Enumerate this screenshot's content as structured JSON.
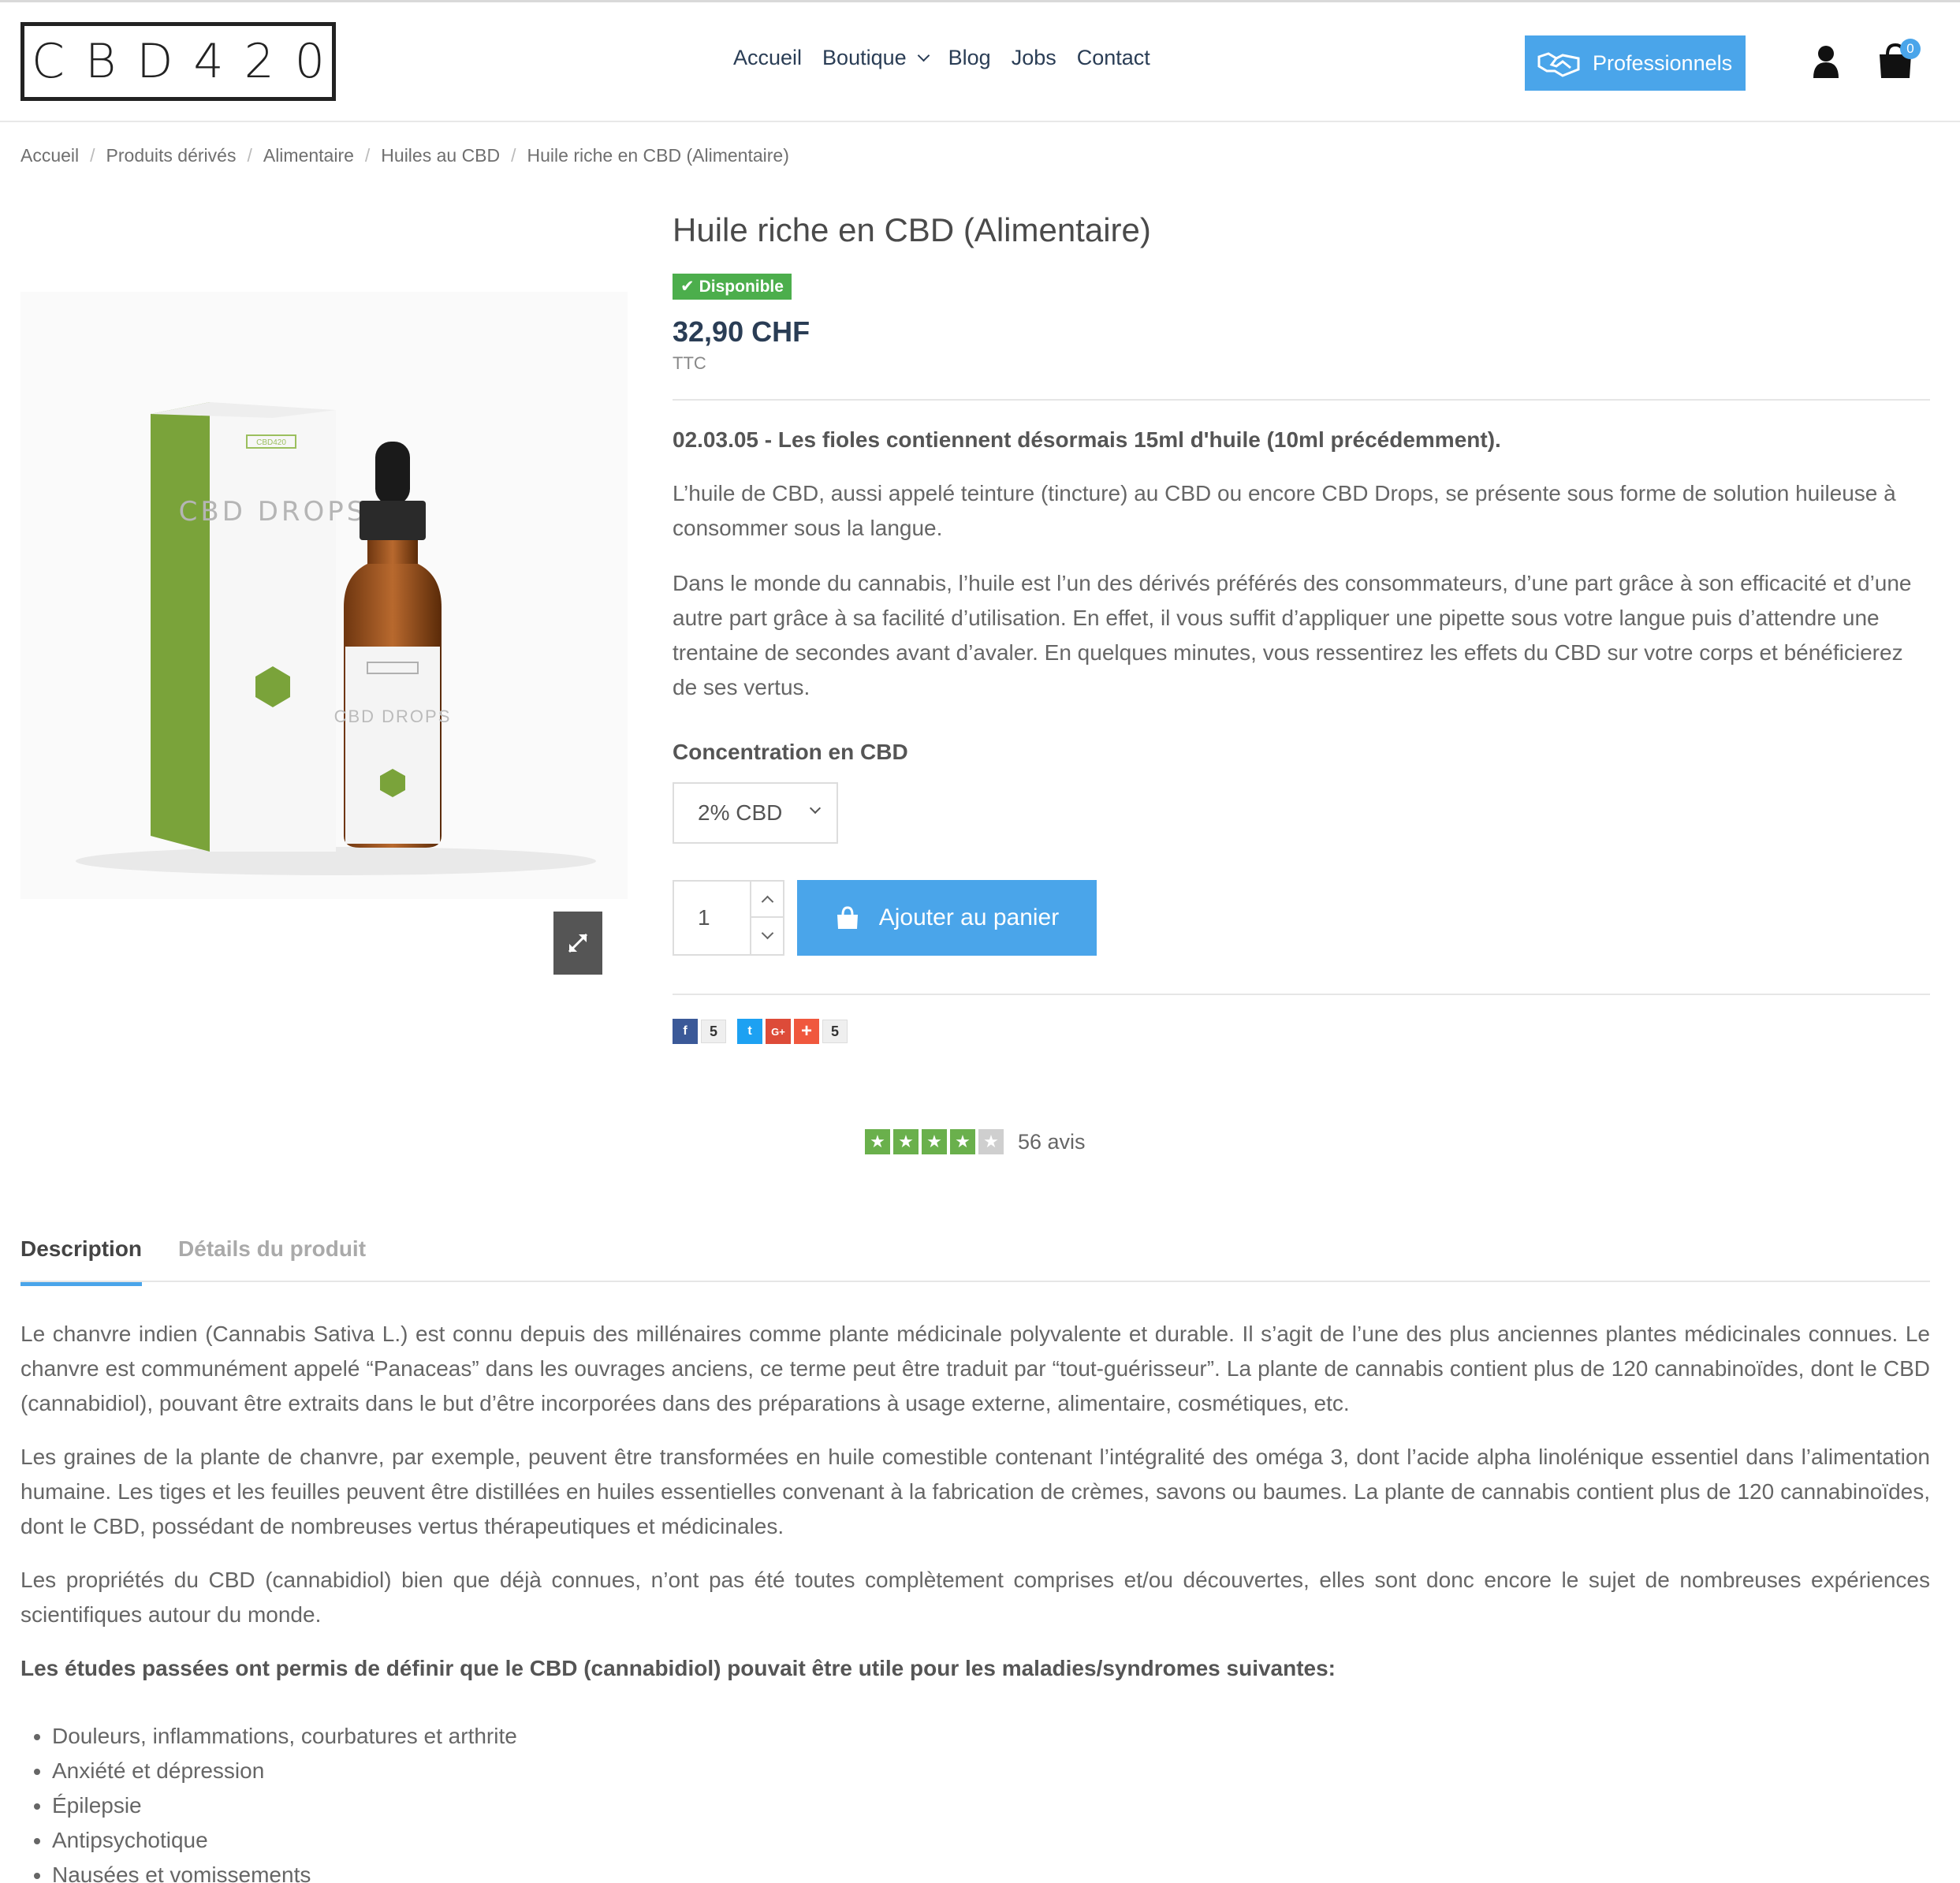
{
  "header": {
    "logo": "CBD420",
    "nav": [
      "Accueil",
      "Boutique",
      "Blog",
      "Jobs",
      "Contact"
    ],
    "pro_button": "Professionnels",
    "cart_count": "0"
  },
  "breadcrumb": [
    "Accueil",
    "Produits dérivés",
    "Alimentaire",
    "Huiles au CBD",
    "Huile riche en CBD (Alimentaire)"
  ],
  "product": {
    "image_box_text": "CBD DROPS",
    "image_brand": "CBD420",
    "title": "Huile riche en CBD (Alimentaire)",
    "availability": "Disponible",
    "price": "32,90 CHF",
    "tax_label": "TTC",
    "notice": "02.03.05 - Les fioles contiennent désormais 15ml d'huile (10ml précédemment).",
    "paragraph1": "L’huile de CBD, aussi appelé teinture (tincture) au CBD ou encore CBD Drops, se présente sous forme de solution huileuse à consommer sous la langue.",
    "paragraph2": "Dans le monde du cannabis, l’huile est l’un des dérivés préférés des consommateurs, d’une part grâce à son efficacité et d’une autre part grâce à sa facilité d’utilisation. En effet, il vous suffit d’appliquer une pipette sous votre langue puis d’attendre une trentaine de secondes avant d’avaler. En quelques minutes, vous ressentirez les effets du CBD sur votre corps et bénéficierez de ses vertus.",
    "concentration_label": "Concentration en CBD",
    "concentration_selected": "2% CBD",
    "quantity": "1",
    "add_to_cart": "Ajouter au panier",
    "social": {
      "facebook_count": "5",
      "share_count": "5"
    }
  },
  "rating": {
    "stars": 4,
    "max": 5,
    "text": "56 avis"
  },
  "tabs": [
    "Description",
    "Détails du produit"
  ],
  "description": {
    "p1": "Le chanvre indien (Cannabis Sativa L.) est connu depuis des millénaires comme plante médicinale polyvalente et durable. Il s’agit de l’une des plus anciennes plantes médicinales connues. Le chanvre est communément appelé “Panaceas” dans les ouvrages anciens, ce terme peut être traduit par “tout-guérisseur”. La plante de cannabis contient plus de 120 cannabinoïdes, dont le CBD (cannabidiol), pouvant être extraits dans le but d’être incorporées dans des préparations à usage externe, alimentaire, cosmétiques, etc.",
    "p2": "Les graines de la plante de chanvre, par exemple, peuvent être transformées en huile comestible contenant l’intégralité des oméga 3, dont l’acide alpha linolénique essentiel dans l’alimentation humaine. Les tiges et les feuilles peuvent être distillées en huiles essentielles convenant à la fabrication de crèmes, savons ou baumes. La plante de cannabis contient plus de 120 cannabinoïdes, dont le CBD, possédant de nombreuses vertus thérapeutiques et médicinales.",
    "p3": "Les propriétés du CBD (cannabidiol) bien que déjà connues, n’ont pas été toutes complètement comprises et/ou découvertes, elles sont donc encore le sujet de nombreuses expériences scientifiques autour du monde.",
    "p4": "Les études passées ont permis de définir que le CBD (cannabidiol) pouvait être utile pour les maladies/syndromes suivantes:",
    "list": [
      "Douleurs, inflammations, courbatures et arthrite",
      "Anxiété et dépression",
      "Épilepsie",
      "Antipsychotique",
      "Nausées et vomissements"
    ]
  },
  "colors": {
    "accent": "#4aa5ea",
    "navy": "#2a3d55",
    "green": "#6ab04c",
    "available": "#4cae4c"
  }
}
